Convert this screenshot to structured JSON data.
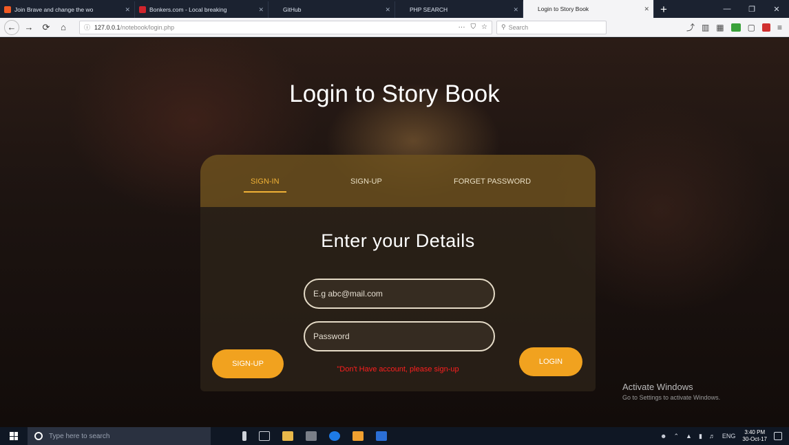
{
  "browser": {
    "tabs": [
      {
        "label": "Join Brave and change the wo",
        "color": "#f05a24",
        "active": false
      },
      {
        "label": "Bonkers.com - Local breaking",
        "color": "#d0242c",
        "active": false
      },
      {
        "label": "GitHub",
        "color": "#1b2230",
        "active": false
      },
      {
        "label": "PHP SEARCH",
        "color": "#1b2230",
        "active": false
      },
      {
        "label": "Login to Story Book",
        "color": "#f4f4f6",
        "active": true
      }
    ],
    "tab_close": "✕",
    "new_tab": "+",
    "window_controls": [
      "—",
      "❐",
      "✕"
    ],
    "url_host": "127.0.0.1",
    "url_path": "/notebook/login.php",
    "url_actions": [
      "···",
      "⛉",
      "☆"
    ],
    "search_placeholder": "Search",
    "nav_icons": [
      "back-arrow-icon",
      "forward-arrow-icon",
      "reload-icon",
      "home-icon"
    ]
  },
  "page": {
    "title": "Login to Story Book",
    "tabs": [
      {
        "label": "SIGN-IN",
        "active": true
      },
      {
        "label": "SIGN-UP",
        "active": false
      },
      {
        "label": "FORGET PASSWORD",
        "active": false
      }
    ],
    "form_heading": "Enter your Details",
    "email_placeholder": "E.g abc@mail.com",
    "password_placeholder": "Password",
    "signup_button": "SIGN-UP",
    "login_button": "LOGIN",
    "warning": "\"Don't Have account, please sign-up"
  },
  "watermark": {
    "line1": "Activate Windows",
    "line2": "Go to Settings to activate Windows."
  },
  "taskbar": {
    "search_placeholder": "Type here to search",
    "language": "ENG",
    "time": "3:40 PM",
    "date": "30-Oct-17"
  },
  "colors": {
    "accent": "#f1a21f",
    "warning": "#ff1f1f"
  }
}
